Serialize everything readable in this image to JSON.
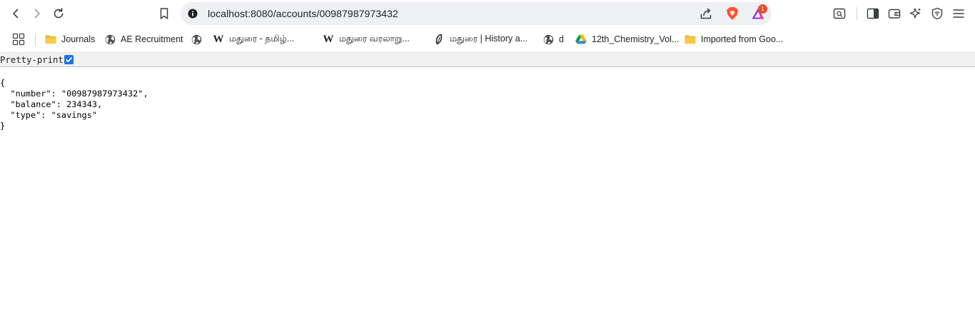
{
  "toolbar": {
    "back_icon": "chevron-left-icon",
    "forward_icon": "chevron-right-icon",
    "reload_icon": "reload-icon",
    "bookmark_icon": "bookmark-icon",
    "url": "localhost:8080/accounts/00987987973432",
    "rewards_badge": "1",
    "brave_color": "#fb542b",
    "rewards_color": "#8a35ff"
  },
  "bookmarks": [
    {
      "label": "Journals",
      "icon": "folder-icon"
    },
    {
      "label": "AE Recruitment",
      "icon": "globe-icon"
    },
    {
      "label": "",
      "icon": "globe-icon"
    },
    {
      "label": "மதுரை - தமிழ்...",
      "icon": "wikipedia-icon"
    },
    {
      "label": "மதுரை வரலாறு...",
      "icon": "wikipedia-icon"
    },
    {
      "label": "மதுரை | History a...",
      "icon": "leaf-icon"
    },
    {
      "label": "d",
      "icon": "globe-icon"
    },
    {
      "label": "12th_Chemistry_Vol...",
      "icon": "google-drive-icon"
    },
    {
      "label": "Imported from Goo...",
      "icon": "folder-icon"
    }
  ],
  "pretty_print": {
    "label": "Pretty-print",
    "checked": true
  },
  "json_lines": [
    "{",
    "  \"number\": \"00987987973432\",",
    "  \"balance\": 234343,",
    "  \"type\": \"savings\"",
    "}"
  ]
}
